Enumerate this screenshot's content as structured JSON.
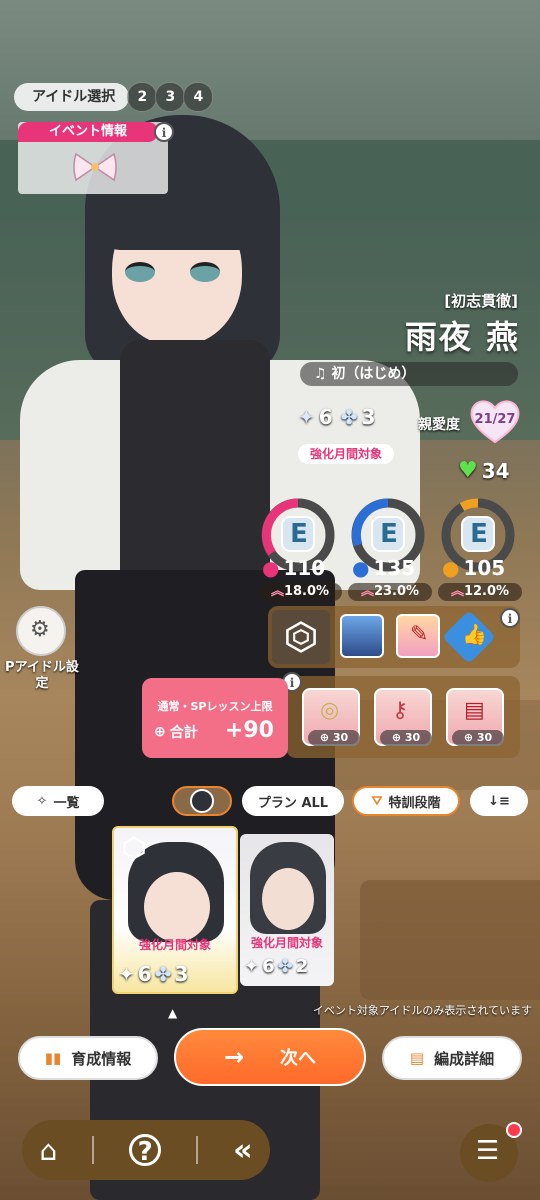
{
  "header": {
    "idol_select_label": "アイドル選択",
    "pages": [
      "2",
      "3",
      "4"
    ]
  },
  "event": {
    "label": "イベント情報"
  },
  "idol": {
    "epithet": "[初志貫徹]",
    "name": "雨夜 燕",
    "song": "初（はじめ）",
    "rank_a": "6",
    "rank_b": "3",
    "affection_label": "親愛度",
    "affection": "21/27",
    "boost_tag": "強化月間対象",
    "stamina": "34"
  },
  "stats": [
    {
      "grade": "E",
      "value": "110",
      "pct": "18.0%",
      "color": "#e8357a"
    },
    {
      "grade": "E",
      "value": "135",
      "pct": "23.0%",
      "color": "#2b6fd6"
    },
    {
      "grade": "E",
      "value": "105",
      "pct": "12.0%",
      "color": "#f0a020"
    }
  ],
  "lesson": {
    "title": "通常・SPレッスン上限",
    "sum_label": "合計",
    "sum_value": "+90"
  },
  "p_items": [
    {
      "name": "mirror-item",
      "count": "30"
    },
    {
      "name": "ribbon-key-item",
      "count": "30"
    },
    {
      "name": "book-item",
      "count": "30"
    }
  ],
  "side": {
    "p_idol_label": "Pアイドル設定"
  },
  "filters": {
    "list_label": "一覧",
    "plan_label": "プラン ALL",
    "training_label": "特訓段階"
  },
  "cards": [
    {
      "tag": "強化月間対象",
      "a": "6",
      "b": "3"
    },
    {
      "tag": "強化月間対象",
      "a": "6",
      "b": "2"
    }
  ],
  "notice": "イベント対象アイドルのみ表示されています",
  "bottom": {
    "info_label": "育成情報",
    "next_label": "次へ",
    "detail_label": "編成詳細"
  },
  "colors": {
    "accent_pink": "#e8357a",
    "accent_orange": "#ff7a32",
    "nav_brown": "#6b4d23"
  }
}
